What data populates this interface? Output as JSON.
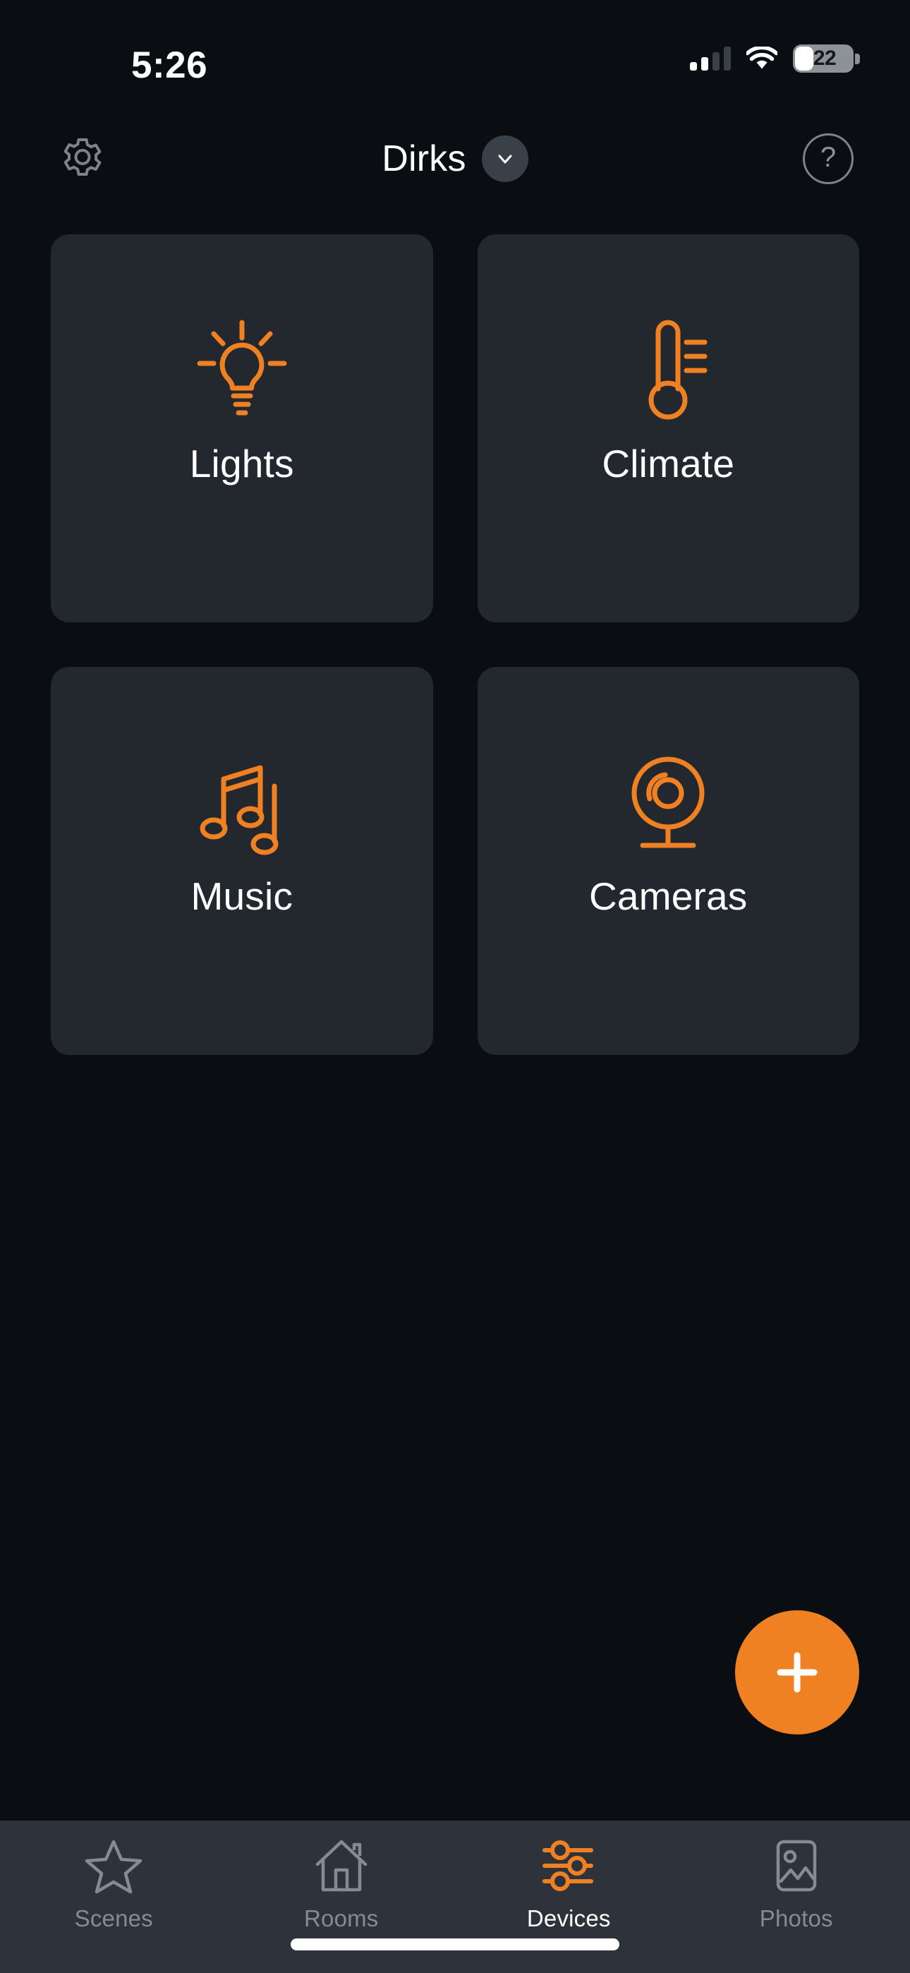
{
  "status_bar": {
    "time": "5:26",
    "cellular_icon": "cellular-signal-icon",
    "cellular_bars_filled": 2,
    "cellular_bars_total": 4,
    "wifi_icon": "wifi-icon",
    "battery_icon": "battery-icon",
    "battery_level": "22"
  },
  "header": {
    "settings_icon": "gear-icon",
    "title": "Dirks",
    "dropdown_icon": "chevron-down-icon",
    "help_icon": "question-mark-icon",
    "help_label": "?"
  },
  "main": {
    "cards": [
      {
        "label": "Lights",
        "icon": "lightbulb-icon"
      },
      {
        "label": "Climate",
        "icon": "thermometer-icon"
      },
      {
        "label": "Music",
        "icon": "music-note-icon"
      },
      {
        "label": "Cameras",
        "icon": "webcam-icon"
      }
    ],
    "fab": {
      "icon": "plus-icon",
      "label": "+"
    }
  },
  "tab_bar": {
    "tabs": [
      {
        "label": "Scenes",
        "icon": "star-icon",
        "active": false
      },
      {
        "label": "Rooms",
        "icon": "house-icon",
        "active": false
      },
      {
        "label": "Devices",
        "icon": "sliders-icon",
        "active": true
      },
      {
        "label": "Photos",
        "icon": "picture-icon",
        "active": false
      }
    ]
  },
  "colors": {
    "background": "#0a0d11",
    "card": "#23282e",
    "accent": "#f08123",
    "tab_bar": "#2e333b",
    "inactive": "#868b93",
    "text": "#ffffff"
  }
}
